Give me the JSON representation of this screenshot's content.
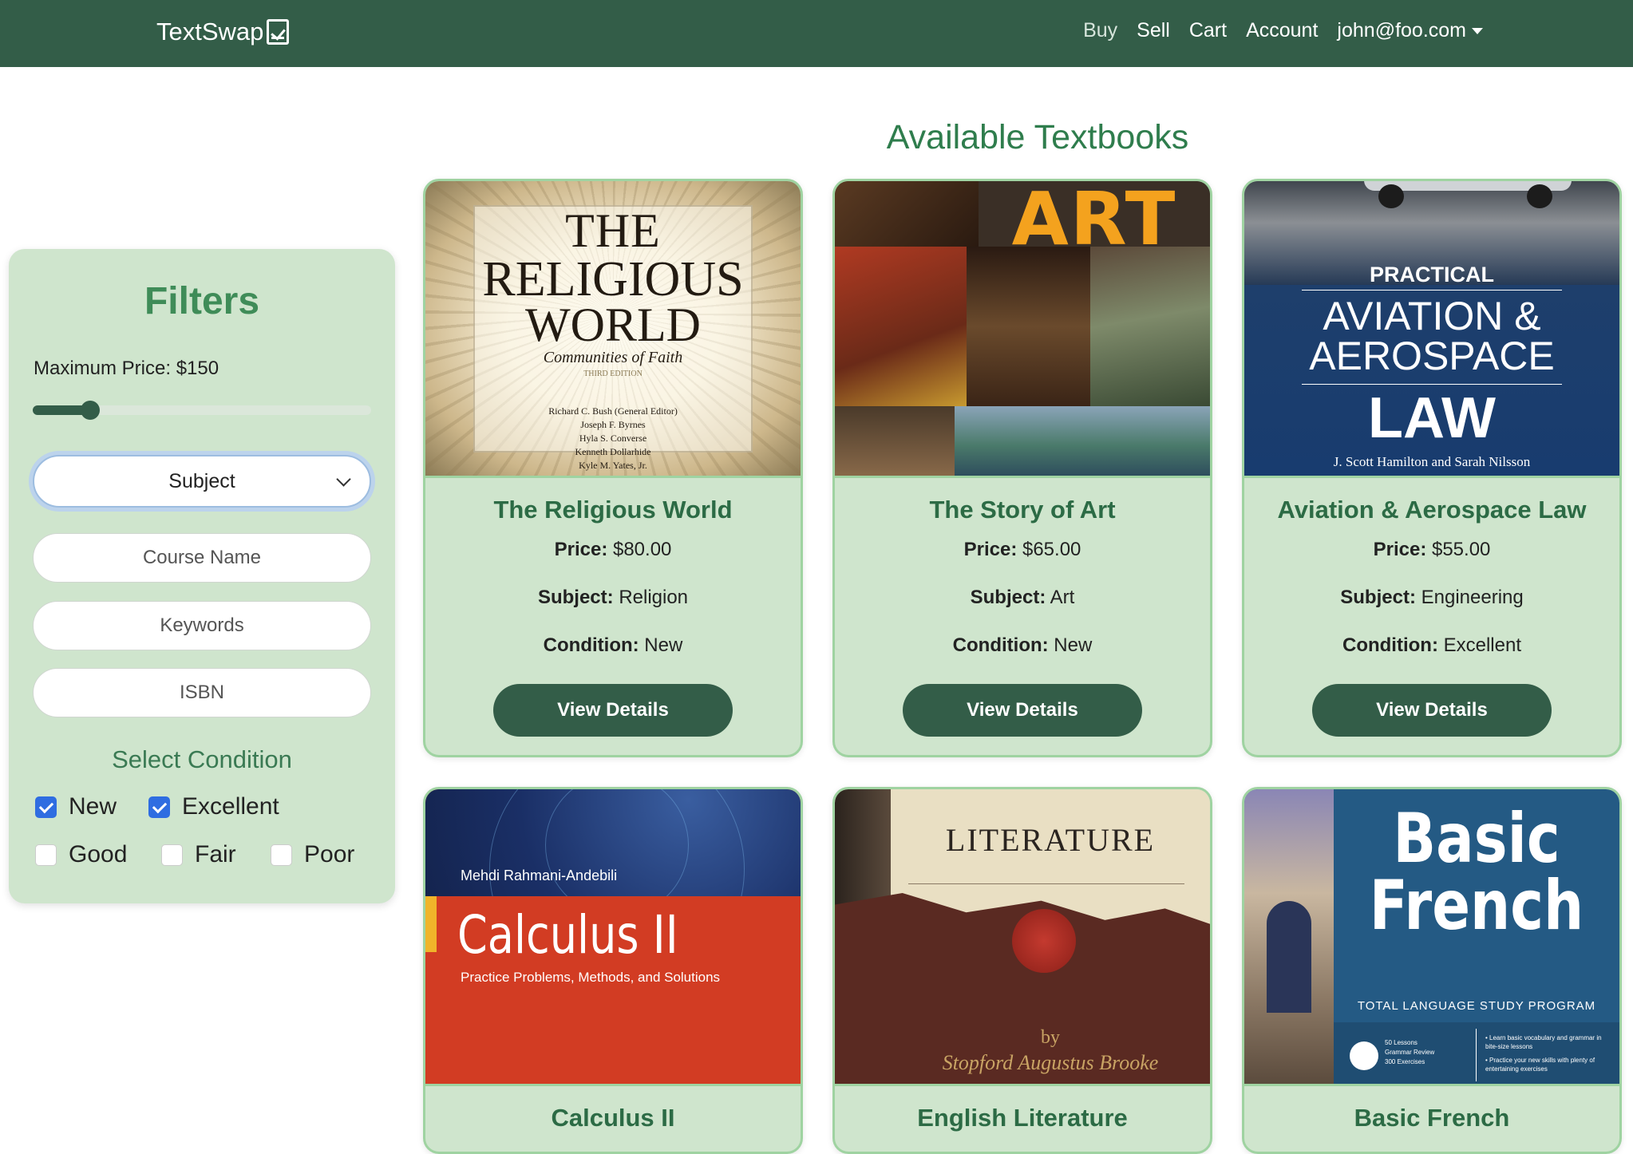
{
  "navbar": {
    "brand": "TextSwap",
    "links": [
      "Buy",
      "Sell",
      "Cart",
      "Account"
    ],
    "user_email": "john@foo.com"
  },
  "page": {
    "title": "Available Textbooks"
  },
  "filters": {
    "title": "Filters",
    "price_label": "Maximum Price: $150",
    "price_fraction": 0.17,
    "subject_select": "Subject",
    "course_placeholder": "Course Name",
    "keywords_placeholder": "Keywords",
    "isbn_placeholder": "ISBN",
    "condition_title": "Select Condition",
    "conditions": [
      {
        "label": "New",
        "checked": true
      },
      {
        "label": "Excellent",
        "checked": true
      },
      {
        "label": "Good",
        "checked": false
      },
      {
        "label": "Fair",
        "checked": false
      },
      {
        "label": "Poor",
        "checked": false
      }
    ]
  },
  "labels": {
    "price": "Price:",
    "subject": "Subject:",
    "condition": "Condition:",
    "view_details": "View Details"
  },
  "books": [
    {
      "title": "The Religious World",
      "price": "$80.00",
      "subject": "Religion",
      "condition": "New"
    },
    {
      "title": "The Story of Art",
      "price": "$65.00",
      "subject": "Art",
      "condition": "New"
    },
    {
      "title": "Aviation & Aerospace Law",
      "price": "$55.00",
      "subject": "Engineering",
      "condition": "Excellent"
    },
    {
      "title": "Calculus II"
    },
    {
      "title": "English Literature"
    },
    {
      "title": "Basic French"
    }
  ],
  "covers": {
    "religious": {
      "l1": "THE",
      "l2": "RELIGIOUS",
      "l3": "WORLD",
      "sub": "Communities of Faith",
      "edition": "THIRD EDITION",
      "authors": [
        "Richard C. Bush (General Editor)",
        "Joseph F. Byrnes",
        "Hyla S. Converse",
        "Kenneth Dollarhide",
        "Kyle M. Yates, Jr."
      ]
    },
    "art": {
      "word": "ART"
    },
    "aviation": {
      "l1": "PRACTICAL",
      "l2": "AVIATION &",
      "l3": "AEROSPACE",
      "l4": "LAW",
      "authors": "J. Scott Hamilton and Sarah Nilsson"
    },
    "calculus": {
      "author": "Mehdi Rahmani-Andebili",
      "title": "Calculus II",
      "sub": "Practice Problems, Methods, and Solutions"
    },
    "literature": {
      "title": "LITERATURE",
      "by": "by",
      "author": "Stopford Augustus Brooke"
    },
    "french": {
      "l1": "Basic",
      "l2": "French",
      "program": "TOTAL LANGUAGE STUDY PROGRAM",
      "lessons": "50 Lessons",
      "grammar": "Grammar Review",
      "exercises": "300 Exercises",
      "bullet1": "• Learn basic vocabulary and grammar in bite-size lessons",
      "bullet2": "• Practice your new skills with plenty of entertaining exercises"
    }
  },
  "colors": {
    "nav": "#335d48",
    "panel": "#cfe5cd",
    "accent": "#2f7d4d",
    "checkbox": "#2f6de1"
  }
}
